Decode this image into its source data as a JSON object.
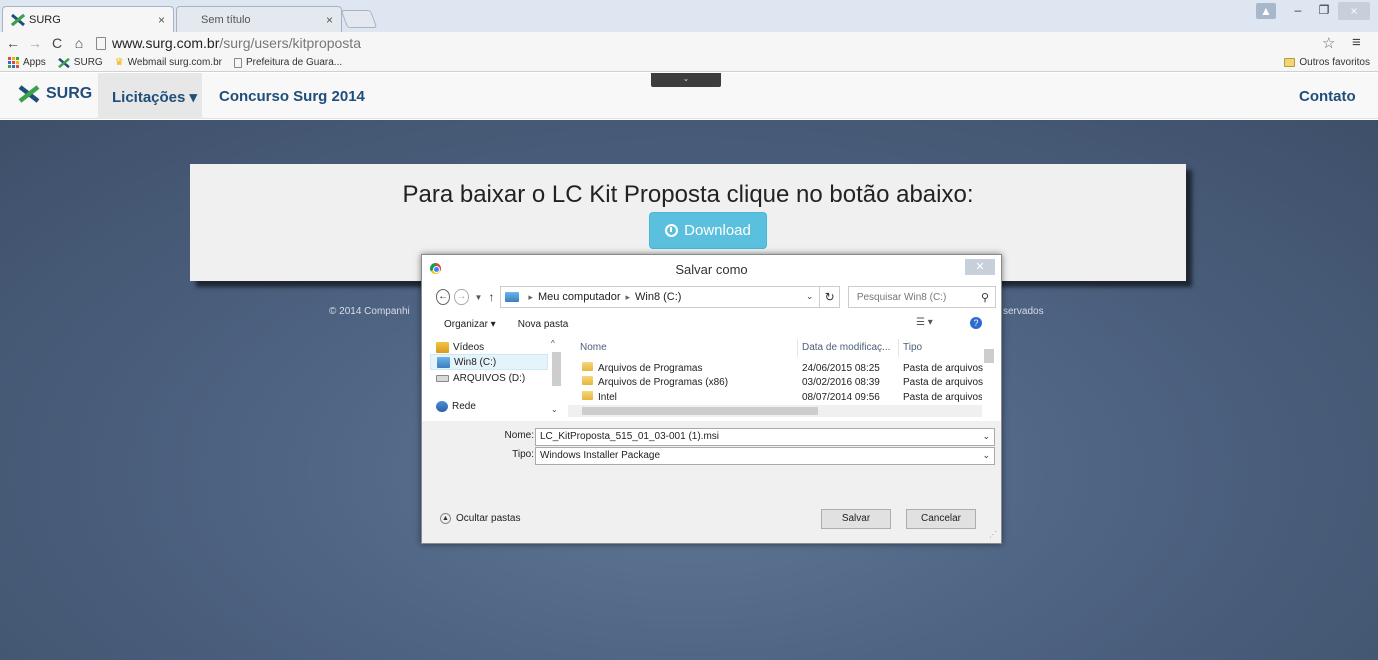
{
  "browser": {
    "tabs": [
      {
        "title": "SURG",
        "close": "×"
      },
      {
        "title": "Sem título",
        "close": "×"
      }
    ],
    "window_controls": {
      "minimize": "–",
      "maximize": "❐",
      "close": "×"
    },
    "url_host": "www.surg.com.br",
    "url_path": "/surg/users/kitproposta",
    "bookmarks": [
      "Apps",
      "SURG",
      "Webmail surg.com.br",
      "Prefeitura de Guara..."
    ],
    "other_bookmarks": "Outros favoritos"
  },
  "site": {
    "brand": "SURG",
    "nav": {
      "licitacoes": "Licitações ▾",
      "concurso": "Concurso Surg 2014",
      "contato": "Contato"
    },
    "heading": "Para baixar o LC Kit Proposta clique no botão abaixo:",
    "download_label": "Download",
    "footer_left": "© 2014 Companhi",
    "footer_right": "servados",
    "accent_color": "#5bc0de"
  },
  "dialog": {
    "title": "Salvar como",
    "breadcrumb": [
      "Meu computador",
      "Win8 (C:)"
    ],
    "search_placeholder": "Pesquisar Win8 (C:)",
    "organize": "Organizar ▾",
    "new_folder": "Nova pasta",
    "left_pane": [
      "Vídeos",
      "Win8 (C:)",
      "ARQUIVOS (D:)",
      "Rede"
    ],
    "columns": {
      "name": "Nome",
      "date": "Data de modificaç...",
      "type": "Tipo"
    },
    "files": [
      {
        "name": "Arquivos de Programas",
        "date": "24/06/2015 08:25",
        "type": "Pasta de arquivos"
      },
      {
        "name": "Arquivos de Programas (x86)",
        "date": "03/02/2016 08:39",
        "type": "Pasta de arquivos"
      },
      {
        "name": "Intel",
        "date": "08/07/2014 09:56",
        "type": "Pasta de arquivos"
      }
    ],
    "filename_label": "Nome:",
    "filename_value": "LC_KitProposta_515_01_03-001 (1).msi",
    "type_label": "Tipo:",
    "type_value": "Windows Installer Package",
    "hide_folders": "Ocultar pastas",
    "save": "Salvar",
    "cancel": "Cancelar"
  }
}
